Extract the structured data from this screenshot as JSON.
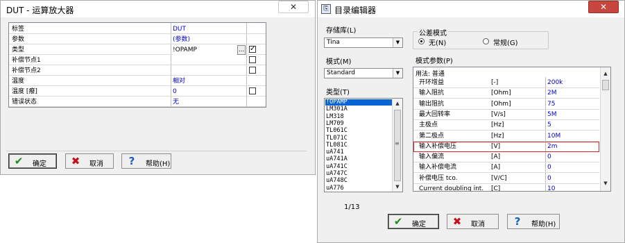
{
  "dut": {
    "title": "DUT - 运算放大器",
    "close": "✕",
    "rows": [
      {
        "label": "标签",
        "value": "DUT",
        "checkbox": false
      },
      {
        "label": "参数",
        "value": "(参数)",
        "checkbox": false
      },
      {
        "label": "类型",
        "value": "!OPAMP",
        "checkbox": true,
        "checked": true,
        "ellipsis": "..."
      },
      {
        "label": "补偿节点1",
        "value": "",
        "checkbox": true,
        "checked": false
      },
      {
        "label": "补偿节点2",
        "value": "",
        "checkbox": true,
        "checked": false
      },
      {
        "label": "温度",
        "value": "相对",
        "checkbox": false
      },
      {
        "label": "温度 [癈]",
        "value": "0",
        "checkbox": true,
        "checked": false
      },
      {
        "label": "错误状态",
        "value": "无",
        "checkbox": false
      }
    ],
    "buttons": {
      "ok": "确定",
      "cancel": "取消",
      "help": "帮助(H)"
    }
  },
  "catalog": {
    "title": "目录编辑器",
    "close": "✕",
    "library_label": "存储库(L)",
    "library_value": "Tina",
    "model_label": "模式(M)",
    "model_value": "Standard",
    "type_label": "类型(T)",
    "types": [
      "!OPAMP",
      "LM301A",
      "LM318",
      "LM709",
      "TL061C",
      "TL071C",
      "TL081C",
      "uA741",
      "uA741A",
      "uA741C",
      "uA747C",
      "uA748C",
      "uA776"
    ],
    "count": "1/13",
    "tolerance_group": "公差模式",
    "tol_none": "无(N)",
    "tol_normal": "常规(G)",
    "params_label": "模式参数(P)",
    "params_header": "用法: 普通",
    "params": [
      {
        "name": "开环增益",
        "unit": "[-]",
        "value": "200k"
      },
      {
        "name": "输入阻抗",
        "unit": "[Ohm]",
        "value": "2M"
      },
      {
        "name": "输出阻抗",
        "unit": "[Ohm]",
        "value": "75"
      },
      {
        "name": "最大回转率",
        "unit": "[V/s]",
        "value": "5M"
      },
      {
        "name": "主极点",
        "unit": "[Hz]",
        "value": "5"
      },
      {
        "name": "第二极点",
        "unit": "[Hz]",
        "value": "10M"
      },
      {
        "name": "输入补偿电压",
        "unit": "[V]",
        "value": "2m"
      },
      {
        "name": "输入偏流",
        "unit": "[A]",
        "value": "0"
      },
      {
        "name": "输入补偿电流",
        "unit": "[A]",
        "value": "0"
      },
      {
        "name": "补偿电压 tco.",
        "unit": "[V/C]",
        "value": "0"
      },
      {
        "name": "Current doubling int.",
        "unit": "[C]",
        "value": "10"
      }
    ],
    "buttons": {
      "ok": "确定",
      "cancel": "取消",
      "help": "帮助(H)"
    },
    "colors": {
      "highlight_border": "#d9262d",
      "selection": "#0a64d6",
      "value_blue": "#0000c8"
    }
  }
}
